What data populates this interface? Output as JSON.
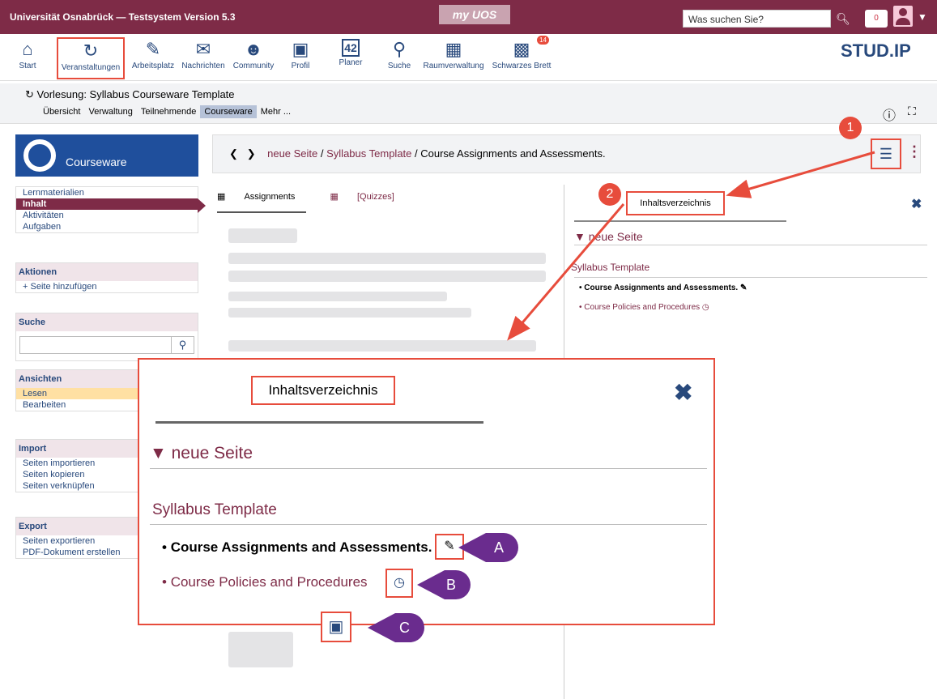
{
  "topbar": {
    "title": "Universität Osnabrück — Testsystem Version 5.3",
    "brand": "my UOS",
    "search_placeholder": "Was suchen Sie?",
    "notifications": "0"
  },
  "nav": [
    {
      "label": "Start",
      "icon": "home-icon"
    },
    {
      "label": "Veranstaltungen",
      "icon": "courses-icon"
    },
    {
      "label": "Arbeitsplatz",
      "icon": "workplace-icon"
    },
    {
      "label": "Nachrichten",
      "icon": "mail-icon"
    },
    {
      "label": "Community",
      "icon": "community-icon"
    },
    {
      "label": "Profil",
      "icon": "profile-icon"
    },
    {
      "label": "Planer",
      "icon": "calendar-icon",
      "icon_text": "42"
    },
    {
      "label": "Suche",
      "icon": "search-icon"
    },
    {
      "label": "Raumverwaltung",
      "icon": "room-icon"
    },
    {
      "label": "Schwarzes Brett",
      "icon": "board-icon",
      "badge": "14"
    }
  ],
  "logo": "STUD.IP",
  "context": {
    "title": "Vorlesung: Syllabus Courseware Template",
    "tabs": [
      "Übersicht",
      "Verwaltung",
      "Teilnehmende",
      "Courseware",
      "Mehr ..."
    ]
  },
  "sidebar": {
    "header": "Courseware",
    "nav": [
      "Lernmaterialien",
      "Inhalt",
      "Aktivitäten",
      "Aufgaben"
    ],
    "aktionen": {
      "title": "Aktionen",
      "items": [
        "Seite hinzufügen"
      ]
    },
    "suche": {
      "title": "Suche"
    },
    "ansichten": {
      "title": "Ansichten",
      "items": [
        "Lesen",
        "Bearbeiten"
      ]
    },
    "import": {
      "title": "Import",
      "items": [
        "Seiten importieren",
        "Seiten kopieren",
        "Seiten verknüpfen"
      ]
    },
    "export": {
      "title": "Export",
      "items": [
        "Seiten exportieren",
        "PDF-Dokument erstellen"
      ]
    }
  },
  "breadcrumb": {
    "a": "neue Seite",
    "b": "Syllabus Template",
    "c": "Course Assignments and Assessments."
  },
  "content_tabs": [
    "Assignments",
    "[Quizzes]"
  ],
  "toc": {
    "tab": "Inhaltsverzeichnis",
    "page": "neue Seite",
    "section": "Syllabus Template",
    "items": [
      "Course Assignments and Assessments.",
      "Course Policies and Procedures"
    ]
  },
  "callouts": {
    "one": "1",
    "two": "2",
    "a": "A",
    "b": "B",
    "c": "C"
  },
  "colors": {
    "brand": "#7e2b47",
    "accent": "#e74c3c",
    "callout": "#6a2c8e"
  }
}
